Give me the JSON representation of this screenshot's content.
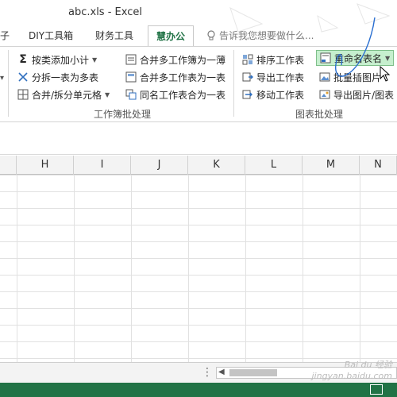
{
  "window": {
    "title": "abc.xls - Excel"
  },
  "tabs": {
    "partial_left": "子",
    "diy": "DIY工具箱",
    "finance": "财务工具",
    "active": "慧办公",
    "tell_me": "告诉我您想要做什么..."
  },
  "ribbon": {
    "workbook_group": {
      "label": "工作簿批处理",
      "subtotal": "按类添加小计",
      "split": "分拆一表为多表",
      "merge_split_cells": "合并/拆分单元格",
      "merge_workbooks": "合并多工作簿为一薄",
      "merge_sheets": "合并多工作表为一表",
      "same_name": "同名工作表合为一表"
    },
    "chart_group": {
      "label": "图表批处理",
      "sort": "排序工作表",
      "export": "导出工作表",
      "move": "移动工作表",
      "rename": "重命名表名",
      "batch_insert": "批量插图片",
      "export_image": "导出图片/图表"
    }
  },
  "columns": [
    "H",
    "I",
    "J",
    "K",
    "L",
    "M",
    "N"
  ],
  "watermark": "Bai du 经验\njingyan.baidu.com",
  "colors": {
    "accent": "#217346",
    "highlight": "#c6efce",
    "pen": "#2a6fd1"
  }
}
